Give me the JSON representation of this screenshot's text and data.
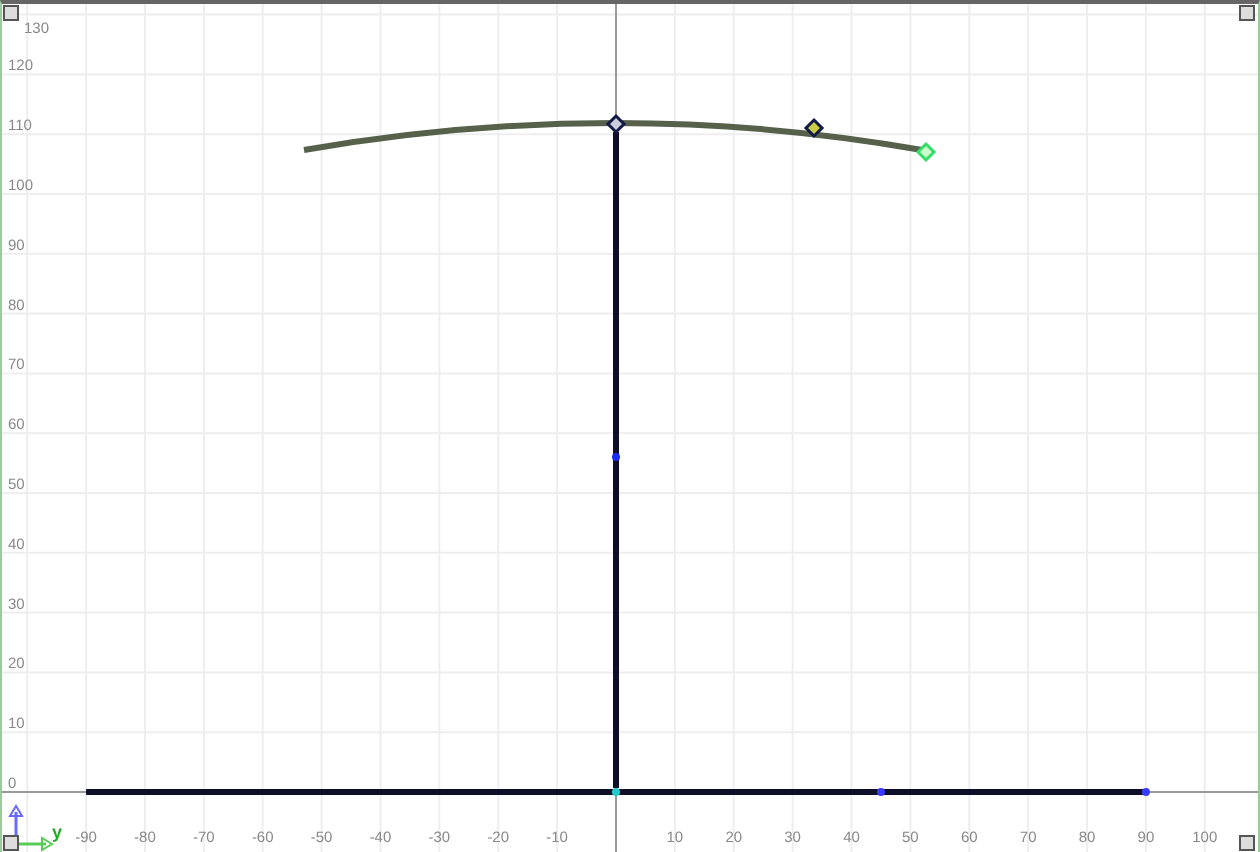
{
  "viewport": {
    "x_labels_negative": [
      "-90",
      "-80",
      "-70",
      "-60",
      "-50",
      "-40",
      "-30",
      "-20",
      "-10"
    ],
    "x_labels_positive": [
      "10",
      "20",
      "30",
      "40",
      "50",
      "60",
      "70",
      "80",
      "90",
      "100"
    ],
    "y_labels": [
      "130",
      "120",
      "110",
      "100",
      "90",
      "80",
      "70",
      "60",
      "50",
      "40",
      "30",
      "20",
      "10",
      "0"
    ],
    "axis_triad": {
      "label": "y"
    }
  }
}
